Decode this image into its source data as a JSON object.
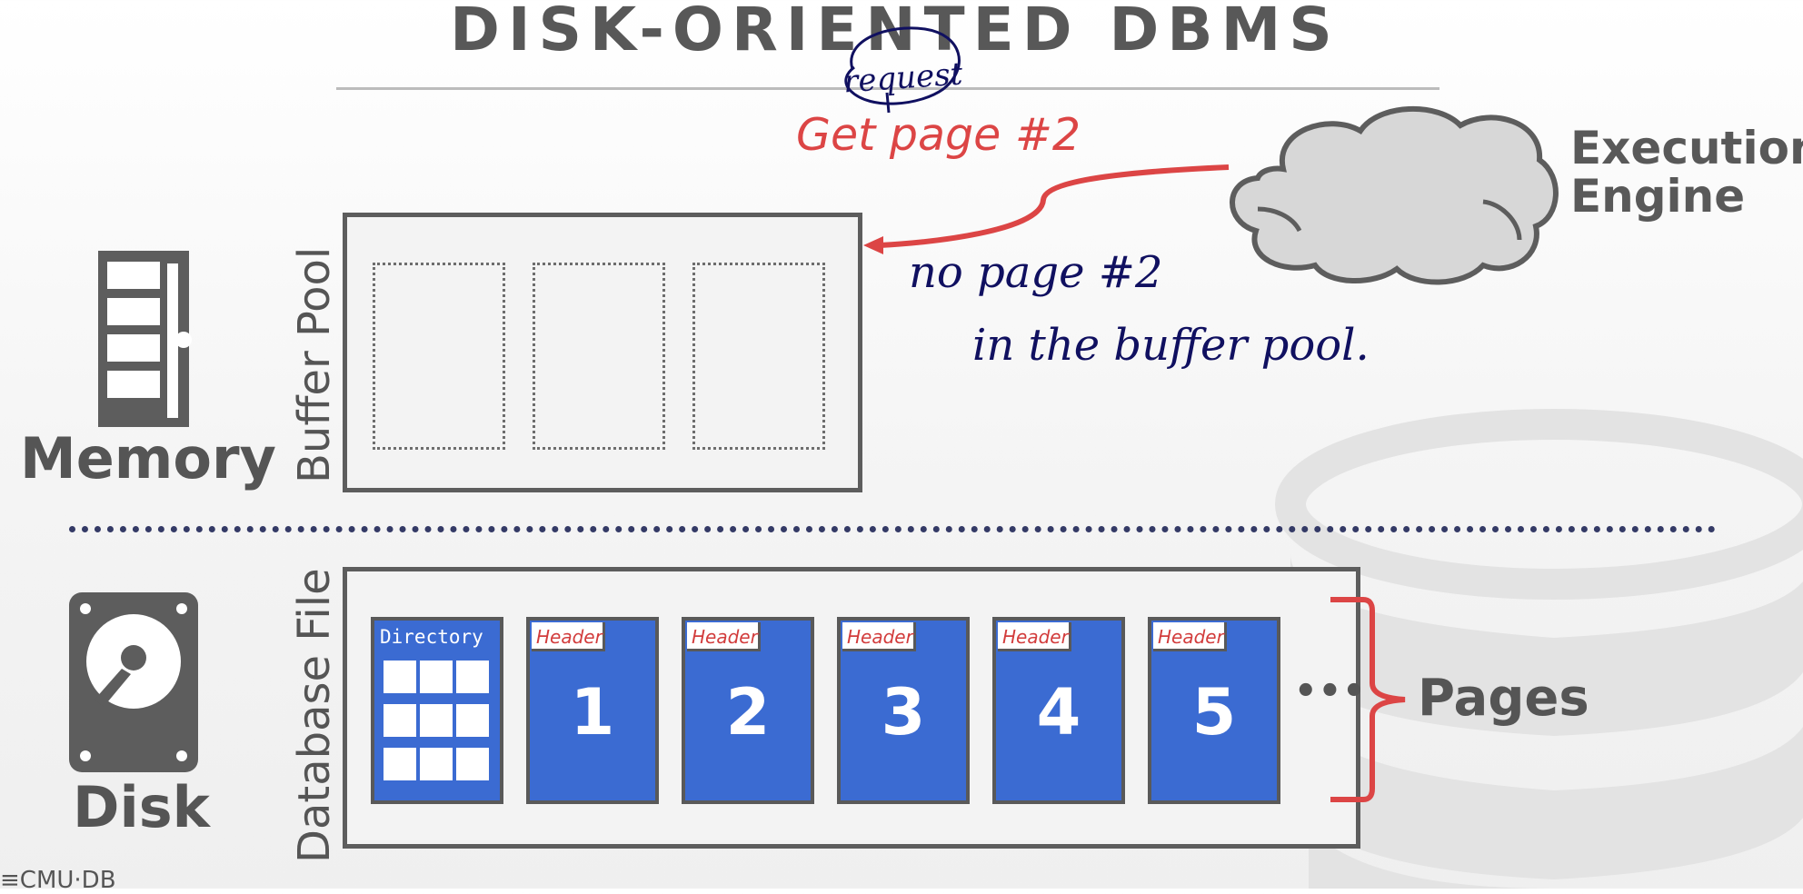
{
  "slide": {
    "title": "DISK-ORIENTED DBMS",
    "request_label": "Get page #2",
    "execution_engine": {
      "line1": "Execution",
      "line2": "Engine"
    }
  },
  "memory": {
    "label": "Memory",
    "buffer_pool_label": "Buffer Pool",
    "frame_count": 3
  },
  "disk": {
    "label": "Disk",
    "database_file_label": "Database File",
    "directory_label": "Directory",
    "pages": [
      {
        "header": "Header",
        "number": "1"
      },
      {
        "header": "Header",
        "number": "2"
      },
      {
        "header": "Header",
        "number": "3"
      },
      {
        "header": "Header",
        "number": "4"
      },
      {
        "header": "Header",
        "number": "5"
      }
    ],
    "ellipsis": "•••",
    "pages_label": "Pages"
  },
  "annotations": {
    "request_note": "request",
    "note_line1": "no page #2",
    "note_line2": "in the buffer pool."
  },
  "footer": {
    "logo": "≡CMU·DB"
  },
  "colors": {
    "accent_red": "#dc4545",
    "page_blue": "#3b6bd2",
    "ink": "#101060",
    "divider": "#343a66"
  },
  "icons": [
    "memory-stick-icon",
    "hard-disk-icon",
    "cloud-icon",
    "database-watermark-icon"
  ]
}
